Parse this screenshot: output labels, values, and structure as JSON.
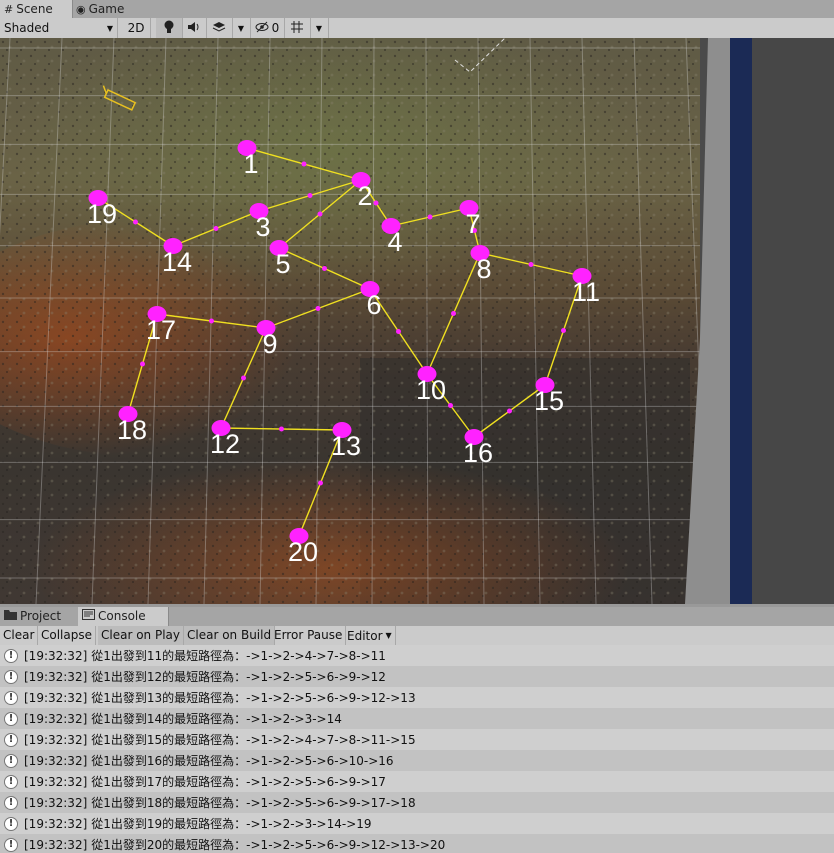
{
  "tabs": {
    "scene": "Scene",
    "game": "Game",
    "project": "Project",
    "console": "Console"
  },
  "scene_toolbar": {
    "draw_mode": "Shaded",
    "mode_2d": "2D",
    "hidden_count": "0"
  },
  "console_toolbar": {
    "clear": "Clear",
    "collapse": "Collapse",
    "clear_on_play": "Clear on Play",
    "clear_on_build": "Clear on Build",
    "error_pause": "Error Pause",
    "editor": "Editor"
  },
  "graph": {
    "node_color": "#ff22ff",
    "edge_color": "#f0e020",
    "nodes": [
      {
        "id": "1",
        "label": "1"
      },
      {
        "id": "2",
        "label": "2"
      },
      {
        "id": "3",
        "label": "3"
      },
      {
        "id": "4",
        "label": "4"
      },
      {
        "id": "5",
        "label": "5"
      },
      {
        "id": "6",
        "label": "6"
      },
      {
        "id": "7",
        "label": "7"
      },
      {
        "id": "8",
        "label": "8"
      },
      {
        "id": "9",
        "label": "9"
      },
      {
        "id": "10",
        "label": "10"
      },
      {
        "id": "11",
        "label": "11"
      },
      {
        "id": "12",
        "label": "12"
      },
      {
        "id": "13",
        "label": "13"
      },
      {
        "id": "14",
        "label": "14"
      },
      {
        "id": "15",
        "label": "15"
      },
      {
        "id": "16",
        "label": "16"
      },
      {
        "id": "17",
        "label": "17"
      },
      {
        "id": "18",
        "label": "18"
      },
      {
        "id": "19",
        "label": "19"
      },
      {
        "id": "20",
        "label": "20"
      }
    ],
    "edges": [
      [
        "1",
        "2"
      ],
      [
        "2",
        "3"
      ],
      [
        "2",
        "4"
      ],
      [
        "2",
        "5"
      ],
      [
        "4",
        "7"
      ],
      [
        "7",
        "8"
      ],
      [
        "8",
        "11"
      ],
      [
        "8",
        "10"
      ],
      [
        "3",
        "14"
      ],
      [
        "14",
        "19"
      ],
      [
        "5",
        "6"
      ],
      [
        "6",
        "9"
      ],
      [
        "6",
        "10"
      ],
      [
        "9",
        "17"
      ],
      [
        "9",
        "12"
      ],
      [
        "17",
        "18"
      ],
      [
        "12",
        "13"
      ],
      [
        "13",
        "20"
      ],
      [
        "10",
        "16"
      ],
      [
        "16",
        "15"
      ],
      [
        "15",
        "11"
      ]
    ]
  },
  "console_logs": [
    {
      "time": "[19:32:32]",
      "message": "從1出發到11的最短路徑為：->1->2->4->7->8->11"
    },
    {
      "time": "[19:32:32]",
      "message": "從1出發到12的最短路徑為：->1->2->5->6->9->12"
    },
    {
      "time": "[19:32:32]",
      "message": "從1出發到13的最短路徑為：->1->2->5->6->9->12->13"
    },
    {
      "time": "[19:32:32]",
      "message": "從1出發到14的最短路徑為：->1->2->3->14"
    },
    {
      "time": "[19:32:32]",
      "message": "從1出發到15的最短路徑為：->1->2->4->7->8->11->15"
    },
    {
      "time": "[19:32:32]",
      "message": "從1出發到16的最短路徑為：->1->2->5->6->10->16"
    },
    {
      "time": "[19:32:32]",
      "message": "從1出發到17的最短路徑為：->1->2->5->6->9->17"
    },
    {
      "time": "[19:32:32]",
      "message": "從1出發到18的最短路徑為：->1->2->5->6->9->17->18"
    },
    {
      "time": "[19:32:32]",
      "message": "從1出發到19的最短路徑為：->1->2->3->14->19"
    },
    {
      "time": "[19:32:32]",
      "message": "從1出發到20的最短路徑為：->1->2->5->6->9->12->13->20"
    }
  ]
}
